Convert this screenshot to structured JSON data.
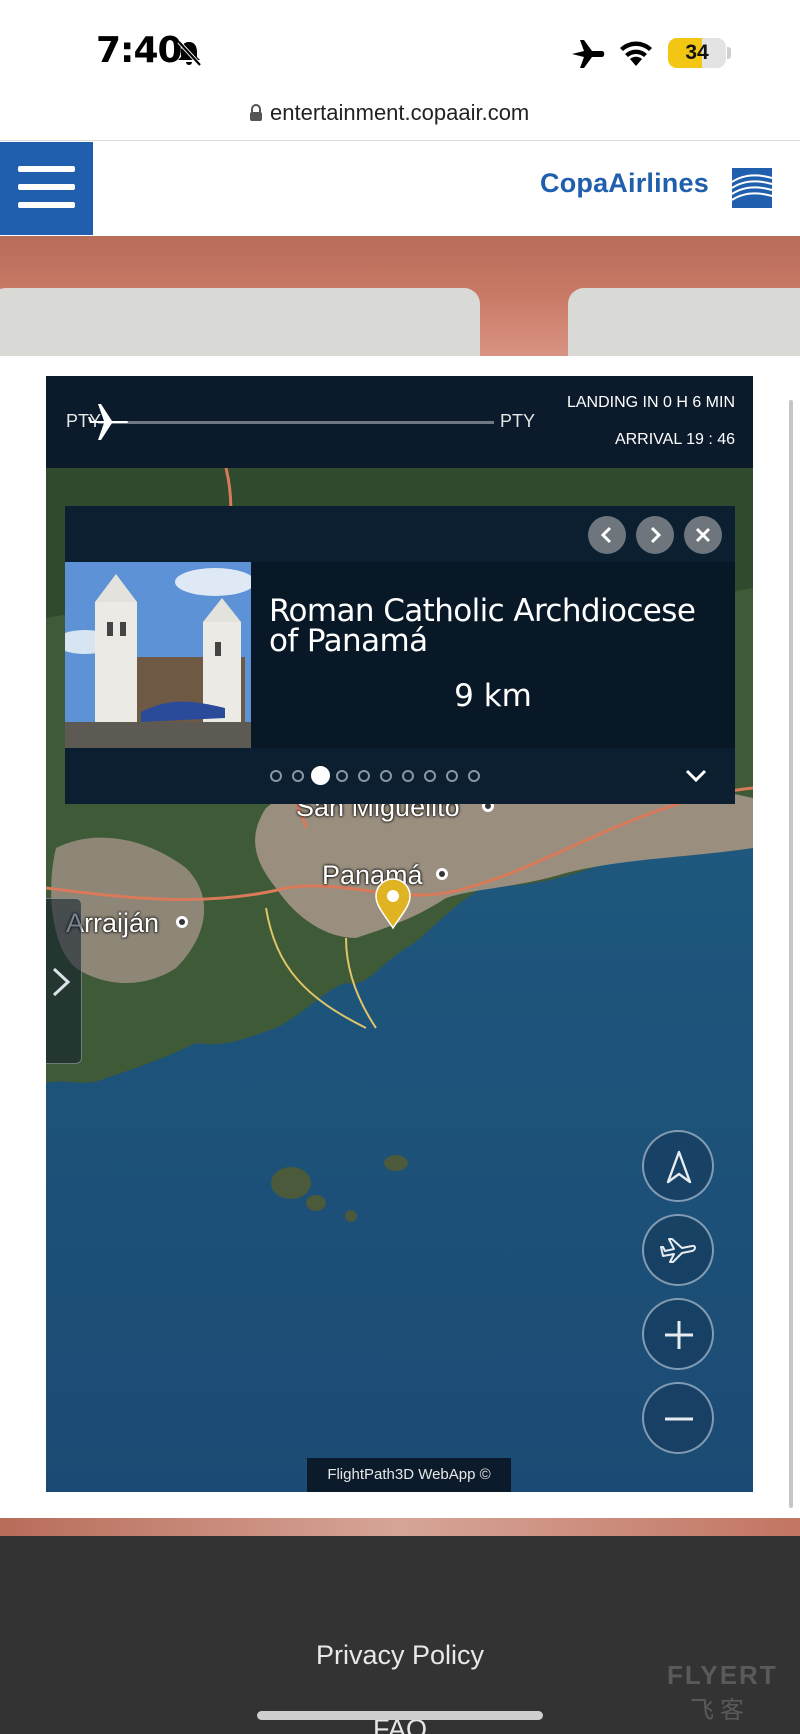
{
  "status_bar": {
    "time": "7:40",
    "battery_level": "34",
    "battery_color": "#f3c614"
  },
  "browser": {
    "url": "entertainment.copaair.com"
  },
  "header": {
    "logo_text": "CopaAirlines",
    "brand_color": "#1f5fae",
    "menu_icon": "hamburger-menu-icon"
  },
  "flight": {
    "origin": "PTY",
    "destination": "PTY",
    "landing": "LANDING IN 0 H 6 MIN",
    "arrival": "ARRIVAL 19 : 46",
    "progress": 0.05
  },
  "poi": {
    "title": "Roman Catholic Archdiocese of Panamá",
    "distance": "9 km",
    "page_count": 10,
    "active_page": 2,
    "icons": [
      "chevron-left-icon",
      "chevron-right-icon",
      "close-icon",
      "chevron-down-icon"
    ]
  },
  "map": {
    "labels": {
      "san_miguelito": "San Miguelito",
      "panama": "Panamá",
      "arraijan": "Arraiján"
    },
    "pin_color": "#e0b323",
    "controls": [
      "north-arrow-icon",
      "airplane-center-icon",
      "zoom-in-icon",
      "zoom-out-icon"
    ],
    "credit": "FlightPath3D WebApp ©"
  },
  "footer": {
    "privacy": "Privacy Policy",
    "faq": "FAQ",
    "watermark": "FLYERT",
    "watermark_sub": "飞客"
  }
}
